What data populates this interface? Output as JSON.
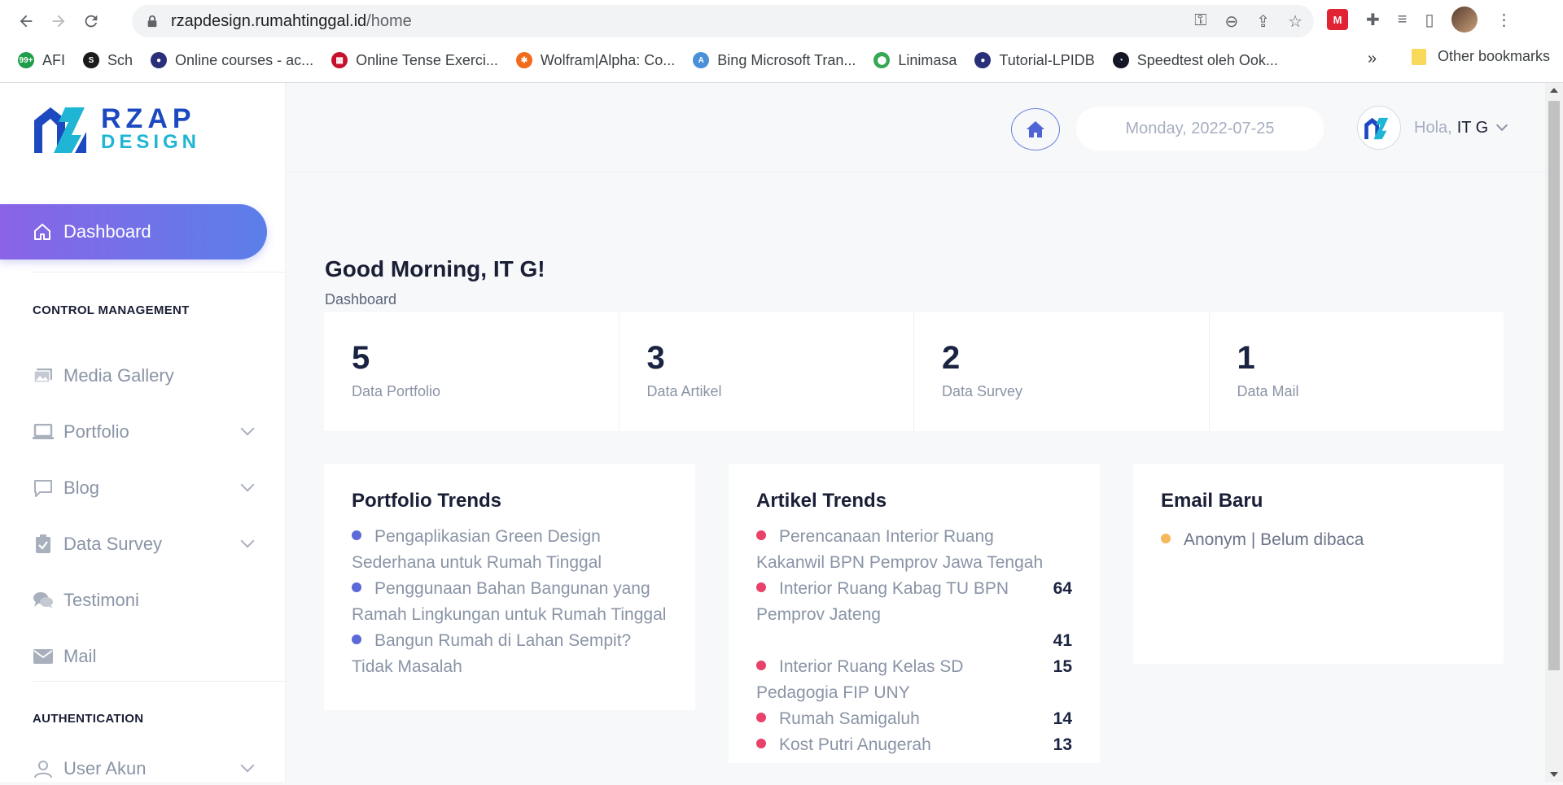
{
  "browser": {
    "url_host": "rzapdesign.rumahtinggal.id",
    "url_path": "/home",
    "bookmarks": [
      {
        "label": "AFI",
        "color": "#1e9e4a",
        "glyph": "99+"
      },
      {
        "label": "Sch",
        "color": "#1a1a1a",
        "glyph": "S"
      },
      {
        "label": "Online courses - ac...",
        "color": "#2a2f7a",
        "glyph": "●"
      },
      {
        "label": "Online Tense Exerci...",
        "color": "#c8102e",
        "glyph": "▦"
      },
      {
        "label": "Wolfram|Alpha: Co...",
        "color": "#f26a1b",
        "glyph": "✱"
      },
      {
        "label": "Bing Microsoft Tran...",
        "color": "#4a90d9",
        "glyph": "A"
      },
      {
        "label": "Linimasa",
        "color": "#34a853",
        "glyph": "⬤"
      },
      {
        "label": "Tutorial-LPIDB",
        "color": "#2a2f7a",
        "glyph": "●"
      },
      {
        "label": "Speedtest oleh Ook...",
        "color": "#141526",
        "glyph": "◔"
      }
    ],
    "more_label": "»",
    "other_bookmarks": "Other bookmarks"
  },
  "brand": {
    "line1": "RZAP",
    "line2": "DESIGN"
  },
  "sidebar": {
    "active": {
      "label": "Dashboard",
      "icon": "home-icon"
    },
    "section1": "CONTROL MANAGEMENT",
    "items": [
      {
        "label": "Media Gallery",
        "icon": "gallery-icon",
        "dropdown": false
      },
      {
        "label": "Portfolio",
        "icon": "laptop-icon",
        "dropdown": true
      },
      {
        "label": "Blog",
        "icon": "chat-icon",
        "dropdown": true
      },
      {
        "label": "Data Survey",
        "icon": "clipboard-icon",
        "dropdown": true
      },
      {
        "label": "Testimoni",
        "icon": "comments-icon",
        "dropdown": false
      },
      {
        "label": "Mail",
        "icon": "envelope-icon",
        "dropdown": false
      }
    ],
    "section2": "AUTHENTICATION",
    "auth_items": [
      {
        "label": "User Akun",
        "icon": "user-icon",
        "dropdown": true
      }
    ]
  },
  "topbar": {
    "date": "Monday, 2022-07-25",
    "greet": "Hola,",
    "user": "IT G"
  },
  "page": {
    "greeting": "Good Morning, IT G!",
    "breadcrumb": "Dashboard"
  },
  "stats": [
    {
      "value": "5",
      "label": "Data Portfolio"
    },
    {
      "value": "3",
      "label": "Data Artikel"
    },
    {
      "value": "2",
      "label": "Data Survey"
    },
    {
      "value": "1",
      "label": "Data Mail"
    }
  ],
  "portfolio_trends": {
    "title": "Portfolio Trends",
    "dot_color": "#5b6ad6",
    "items": [
      "Pengaplikasian Green Design Sederhana untuk Rumah Tinggal",
      "Penggunaan Bahan Bangunan yang Ramah Lingkungan untuk Rumah Tinggal",
      "Bangun Rumah di Lahan Sempit? Tidak Masalah"
    ]
  },
  "artikel_trends": {
    "title": "Artikel Trends",
    "dot_color": "#e8416a",
    "items": [
      {
        "label": "Perencanaan Interior Ruang Kakanwil BPN Pemprov Jawa Tengah",
        "count": ""
      },
      {
        "label": "Interior Ruang Kabag TU BPN Pemprov Jateng",
        "count": "64"
      },
      {
        "label": "",
        "count": "41"
      },
      {
        "label": "Interior Ruang Kelas SD Pedagogia FIP UNY",
        "count": "15"
      },
      {
        "label": "Rumah Samigaluh",
        "count": "14"
      },
      {
        "label": "Kost Putri Anugerah",
        "count": "13"
      }
    ]
  },
  "email": {
    "title": "Email Baru",
    "dot_color": "#f5b95b",
    "items": [
      "Anonym | Belum dibaca"
    ]
  }
}
